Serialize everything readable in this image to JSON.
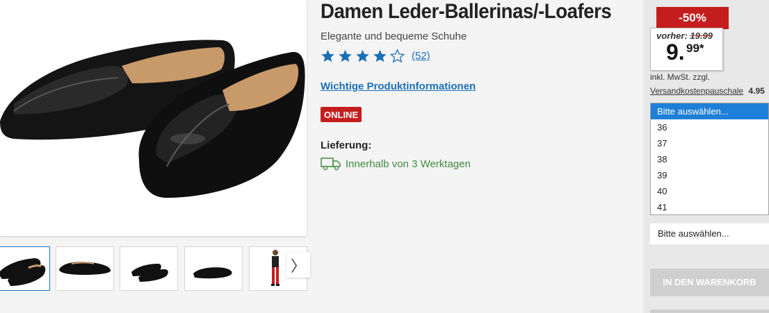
{
  "product": {
    "title": "Damen Leder-Ballerinas/-Loafers",
    "subtitle": "Elegante und bequeme Schuhe",
    "rating_stars": 4,
    "rating_max": 5,
    "rating_count": "(52)",
    "info_link": "Wichtige Produktinformationen",
    "online_badge": "ONLINE",
    "delivery_label": "Lieferung:",
    "delivery_text": "Innerhalb von 3 Werktagen",
    "delivery_icon": "truck-icon"
  },
  "gallery": {
    "thumbnail_count": 5,
    "active_thumbnail": 1,
    "next_arrow": "〉"
  },
  "pricing": {
    "discount": "-50%",
    "was_label": "vorher:",
    "was_price": "19.99",
    "price_whole": "9.",
    "price_cents": "99*",
    "vat_text": "inkl. MwSt. zzgl.",
    "shipping_label": "Versandkostenpauschale",
    "shipping_cost": "4.95"
  },
  "size_selector": {
    "options": [
      "Bitte auswählen...",
      "36",
      "37",
      "38",
      "39",
      "40",
      "41"
    ],
    "selected_index": 0,
    "current_value": "Bitte auswählen..."
  },
  "cart": {
    "button_label": "IN DEN WARENKORB"
  },
  "colors": {
    "accent_red": "#c41d1d",
    "link_blue": "#1a6fb5",
    "star_blue": "#1a6fb5",
    "delivery_green": "#3f8a3f",
    "select_highlight": "#1e7fd8"
  }
}
